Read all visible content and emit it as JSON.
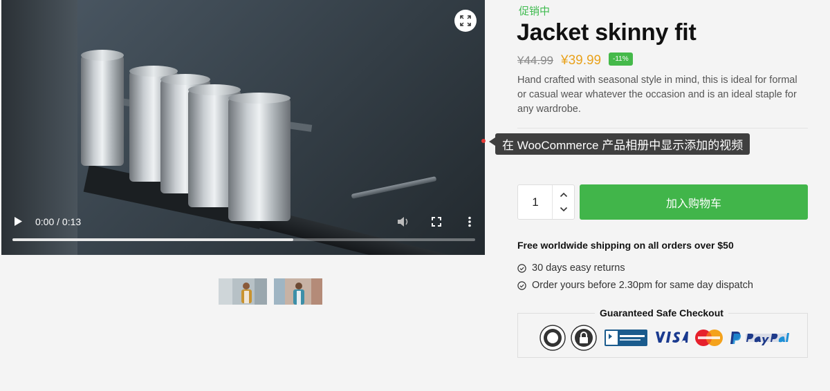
{
  "video": {
    "time_current": "0:00",
    "time_separator": "/",
    "time_total": "0:13",
    "progress": 0.607
  },
  "product": {
    "sale_tag": "促销中",
    "title": "Jacket skinny fit",
    "old_price": "¥44.99",
    "new_price": "¥39.99",
    "discount": "-11%",
    "description": "Hand crafted with seasonal style in mind, this is ideal for formal or casual wear whatever the occasion and is an ideal staple for any wardrobe."
  },
  "tooltip": {
    "text": "在 WooCommerce 产品相册中显示添加的视频"
  },
  "cart": {
    "quantity": "1",
    "add_button": "加入购物车"
  },
  "shipping": {
    "headline": "Free worldwide shipping on all orders over $50",
    "features": [
      "30 days easy returns",
      "Order yours before 2.30pm for same day dispatch"
    ]
  },
  "checkout": {
    "title": "Guaranteed Safe Checkout",
    "badges": [
      "satisfaction-guaranteed-100-badge",
      "secure-checkout-lock-badge",
      "bbb-accredited-business-badge",
      "visa-logo",
      "mastercard-logo",
      "paypal-logo"
    ]
  },
  "colors": {
    "accent_green": "#41b54a",
    "sale_price": "#e9a21c",
    "tooltip_bg": "#3f3f3f"
  }
}
